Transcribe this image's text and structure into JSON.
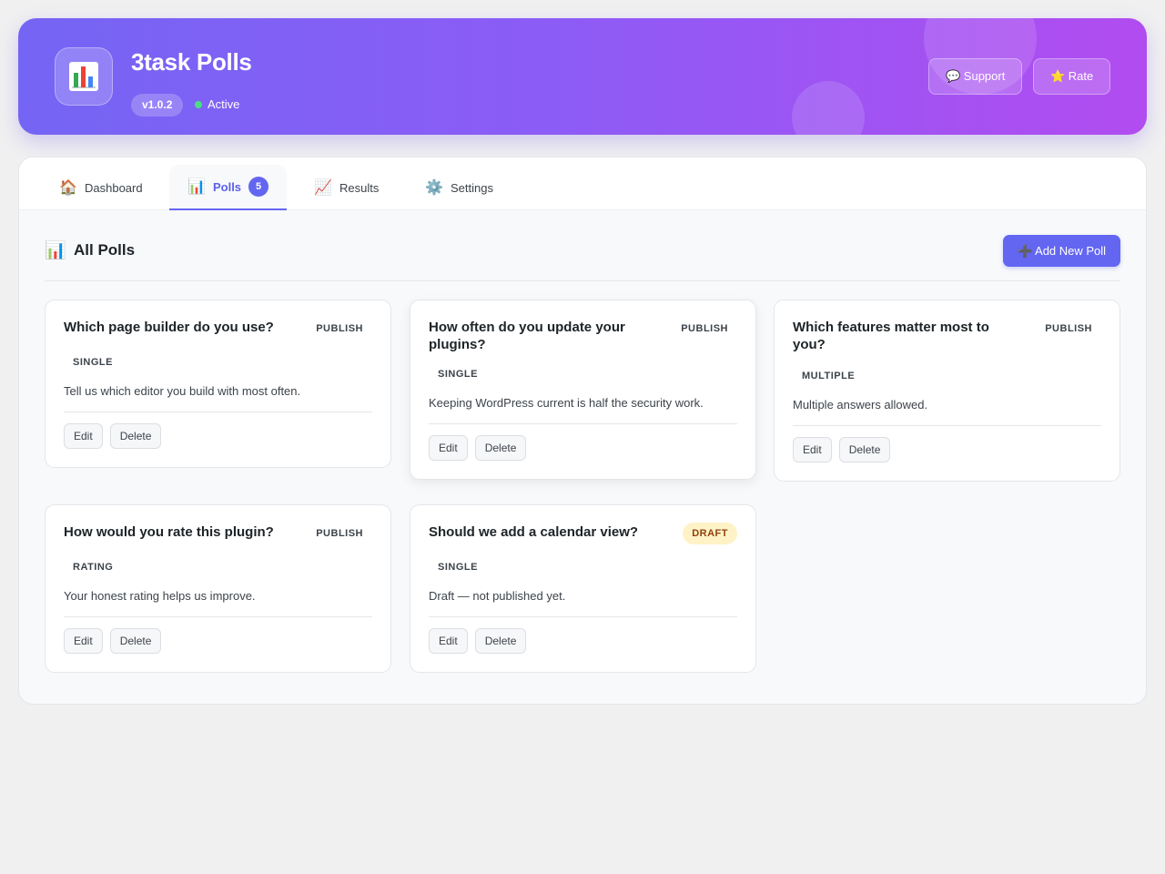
{
  "app": {
    "title": "3task Polls",
    "version": "v1.0.2",
    "status": "Active",
    "icon": "bar-chart-icon",
    "support_label": "💬 Support",
    "rate_label": "⭐ Rate"
  },
  "tabs": [
    {
      "icon": "🏠",
      "label": "Dashboard"
    },
    {
      "icon": "📊",
      "label": "Polls",
      "badge": "5",
      "active": true
    },
    {
      "icon": "📈",
      "label": "Results"
    },
    {
      "icon": "⚙️",
      "label": "Settings"
    }
  ],
  "section": {
    "icon": "📊",
    "title": "All Polls",
    "add_label": "➕ Add New Poll"
  },
  "polls": [
    {
      "title": "Which page builder do you use?",
      "status": "PUBLISH",
      "type": "SINGLE",
      "description": "Tell us which editor you build with most often.",
      "edit": "Edit",
      "delete": "Delete"
    },
    {
      "title": "How often do you update your plugins?",
      "status": "PUBLISH",
      "type": "SINGLE",
      "description": "Keeping WordPress current is half the security work.",
      "edit": "Edit",
      "delete": "Delete"
    },
    {
      "title": "Which features matter most to you?",
      "status": "PUBLISH",
      "type": "MULTIPLE",
      "description": "Multiple answers allowed.",
      "edit": "Edit",
      "delete": "Delete"
    },
    {
      "title": "How would you rate this plugin?",
      "status": "PUBLISH",
      "type": "RATING",
      "description": "Your honest rating helps us improve.",
      "edit": "Edit",
      "delete": "Delete"
    },
    {
      "title": "Should we add a calendar view?",
      "status": "DRAFT",
      "type": "SINGLE",
      "description": "Draft — not published yet.",
      "edit": "Edit",
      "delete": "Delete"
    }
  ],
  "colors": {
    "header_start": "#7565f4",
    "header_end": "#b14cf0",
    "accent": "#6366f1",
    "active_dot": "#4ade80",
    "draft_bg": "#fef3c7",
    "draft_text": "#92400e"
  }
}
